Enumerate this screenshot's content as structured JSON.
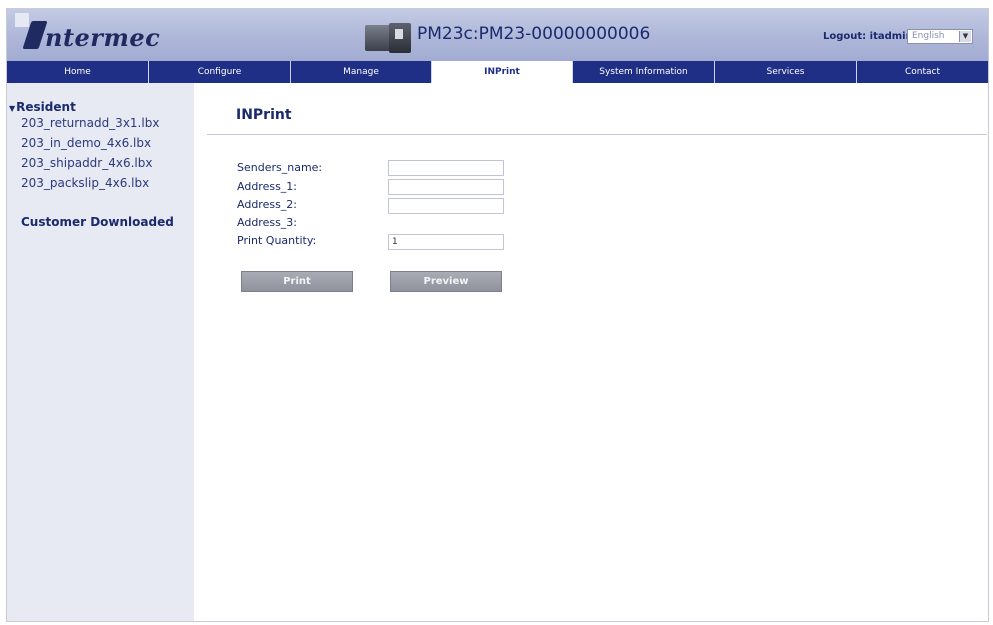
{
  "header": {
    "logo_text": "ntermec",
    "title": "PM23c:PM23-00000000006",
    "logout_label": "Logout: itadmin",
    "language": "English"
  },
  "nav": {
    "items": [
      {
        "label": "Home"
      },
      {
        "label": "Configure"
      },
      {
        "label": "Manage"
      },
      {
        "label": "INPrint",
        "active": true
      },
      {
        "label": "System Information"
      },
      {
        "label": "Services"
      },
      {
        "label": "Contact"
      }
    ]
  },
  "sidebar": {
    "resident_label": "Resident",
    "files": [
      "203_returnadd_3x1.lbx",
      "203_in_demo_4x6.lbx",
      "203_shipaddr_4x6.lbx",
      "203_packslip_4x6.lbx"
    ],
    "customer_label": "Customer Downloaded"
  },
  "main": {
    "title": "INPrint",
    "fields": [
      {
        "label": "Senders_name:",
        "value": "",
        "has_input": true
      },
      {
        "label": "Address_1:",
        "value": "",
        "has_input": true
      },
      {
        "label": "Address_2:",
        "value": "",
        "has_input": true
      },
      {
        "label": "Address_3:",
        "value": "",
        "has_input": false
      },
      {
        "label": "Print Quantity:",
        "value": "1",
        "has_input": true
      }
    ],
    "print_label": "Print",
    "preview_label": "Preview"
  },
  "colors": {
    "nav_bg": "#1f2f86",
    "header_bg": "#aeb7d9",
    "sidebar_bg": "#e7e9f3",
    "text": "#1a2a6c"
  }
}
